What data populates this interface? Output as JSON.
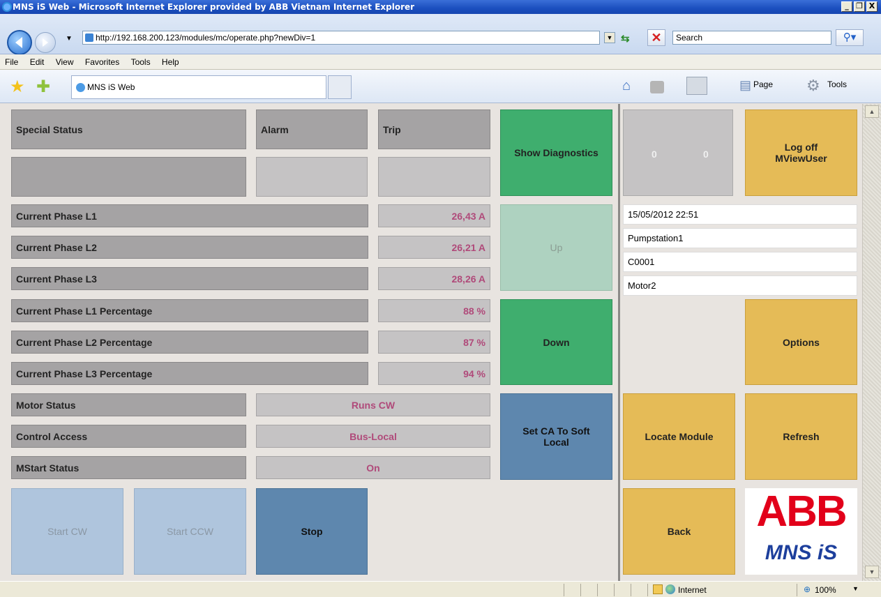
{
  "window": {
    "title": "MNS iS Web - Microsoft Internet Explorer provided by ABB Vietnam Internet Explorer",
    "minimize": "_",
    "maximize": "❐",
    "close": "X"
  },
  "address_bar": {
    "url": "http://192.168.200.123/modules/mc/operate.php?newDiv=1",
    "search_placeholder": "Search"
  },
  "menu": [
    "File",
    "Edit",
    "View",
    "Favorites",
    "Tools",
    "Help"
  ],
  "tab": {
    "label": "MNS iS Web"
  },
  "command_bar": {
    "page": "Page",
    "tools": "Tools"
  },
  "status_header": {
    "special_status": "Special Status",
    "alarm": "Alarm",
    "trip": "Trip"
  },
  "measurements": [
    {
      "label": "Current Phase L1",
      "value": "26,43 A"
    },
    {
      "label": "Current Phase L2",
      "value": "26,21 A"
    },
    {
      "label": "Current Phase L3",
      "value": "28,26 A"
    },
    {
      "label": "Current Phase L1 Percentage",
      "value": "88 %"
    },
    {
      "label": "Current Phase L2 Percentage",
      "value": "87 %"
    },
    {
      "label": "Current Phase L3 Percentage",
      "value": "94 %"
    }
  ],
  "states": [
    {
      "label": "Motor Status",
      "value": "Runs CW"
    },
    {
      "label": "Control Access",
      "value": "Bus-Local"
    },
    {
      "label": "MStart Status",
      "value": "On"
    }
  ],
  "buttons": {
    "show_diagnostics": "Show Diagnostics",
    "up": "Up",
    "down": "Down",
    "set_ca": "Set CA To Soft Local",
    "start_cw": "Start CW",
    "start_ccw": "Start CCW",
    "stop": "Stop",
    "log_off": "Log off MViewUser",
    "options": "Options",
    "locate_module": "Locate Module",
    "refresh": "Refresh",
    "back": "Back"
  },
  "counters": {
    "left": "0",
    "right": "0"
  },
  "info": {
    "datetime": "15/05/2012 22:51",
    "station": "Pumpstation1",
    "code": "C0001",
    "device": "Motor2"
  },
  "logo": {
    "brand": "ABB",
    "product": "MNS iS"
  },
  "status_bar": {
    "zone": "Internet",
    "zoom": "100%"
  },
  "colors": {
    "green": "#3fae6e",
    "blue": "#5e87ae",
    "gold": "#e5bb57",
    "value_text": "#b04a7a",
    "abb_red": "#e2001a",
    "mns_blue": "#1d3f9c"
  }
}
